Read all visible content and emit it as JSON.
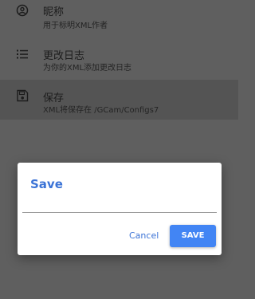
{
  "settings": {
    "items": [
      {
        "icon": "account-circle-icon",
        "title": "昵称",
        "subtitle": "用于标明XML作者"
      },
      {
        "icon": "list-icon",
        "title": "更改日志",
        "subtitle": "为你的XML添加更改日志"
      },
      {
        "icon": "save-icon",
        "title": "保存",
        "subtitle": "XML将保存在 /GCam/Configs7"
      }
    ]
  },
  "dialog": {
    "title": "Save",
    "input_value": "",
    "cancel_label": "Cancel",
    "save_label": "SAVE"
  },
  "colors": {
    "accent": "#3b73d6",
    "primary_button": "#4285f4",
    "scrim": "#5f5f5f"
  }
}
